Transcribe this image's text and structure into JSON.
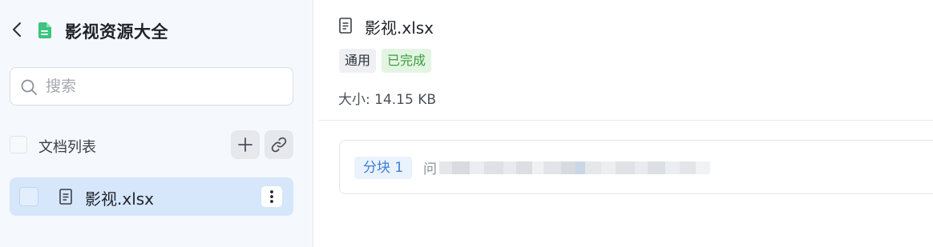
{
  "sidebar": {
    "title": "影视资源大全",
    "search": {
      "placeholder": "搜索",
      "value": ""
    },
    "list_header": {
      "label": "文档列表"
    },
    "documents": [
      {
        "name": "影视.xlsx",
        "selected": true
      }
    ]
  },
  "main": {
    "file_name": "影视.xlsx",
    "tags": {
      "category": "通用",
      "status": "已完成"
    },
    "size_text": "大小: 14.15 KB",
    "chunks": [
      {
        "label": "分块 1",
        "preview_first_char": "问"
      }
    ]
  },
  "colors": {
    "accent": "#3b7fd6",
    "success": "#3a9d3f",
    "selected_row": "#d6e6fb",
    "kb_icon": "#3cc480"
  },
  "icons": [
    "back-arrow-icon",
    "knowledge-base-icon",
    "search-icon",
    "plus-icon",
    "link-icon",
    "document-icon",
    "more-vertical-icon"
  ]
}
